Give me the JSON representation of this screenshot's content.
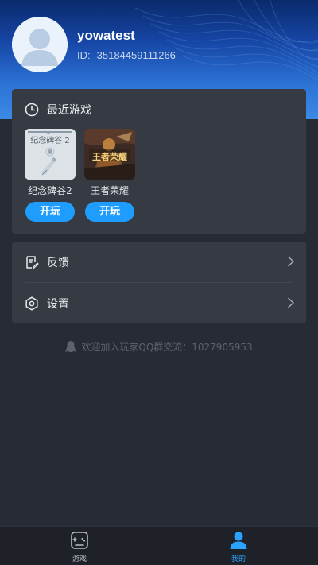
{
  "profile": {
    "username": "yowatest",
    "id_label": "ID:",
    "id_value": "35184459111266"
  },
  "recent": {
    "title": "最近游戏",
    "games": [
      {
        "name": "纪念碑谷2",
        "thumb_text": "纪念碑谷 2",
        "play_label": "开玩"
      },
      {
        "name": "王者荣耀",
        "thumb_text": "王者荣耀",
        "play_label": "开玩"
      }
    ]
  },
  "menu": {
    "items": [
      {
        "label": "反馈",
        "icon": "feedback-icon"
      },
      {
        "label": "设置",
        "icon": "settings-icon"
      }
    ]
  },
  "qq_group": {
    "text": "欢迎加入玩家QQ群交流：1027905953"
  },
  "tabbar": {
    "tabs": [
      {
        "label": "游戏",
        "icon": "gamepad-icon",
        "active": false
      },
      {
        "label": "我的",
        "icon": "person-icon",
        "active": true
      }
    ]
  },
  "colors": {
    "accent": "#1f9dff",
    "background": "#272b33",
    "card": "#353a43",
    "header_top": "#0a2a6b",
    "header_bottom": "#3d8ae6"
  }
}
